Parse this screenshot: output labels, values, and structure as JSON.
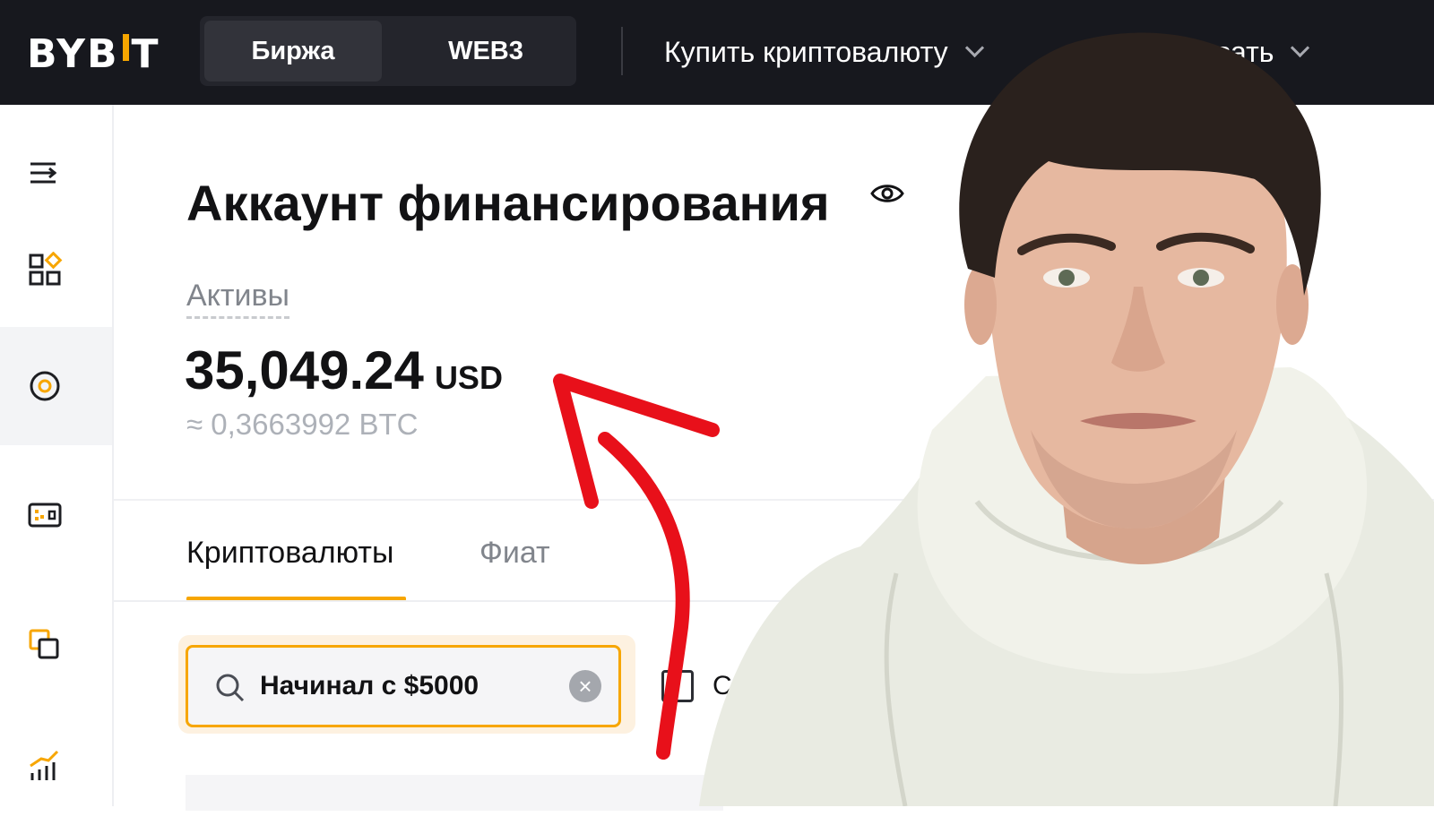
{
  "topbar": {
    "logo": "BYB",
    "logo_suffix": "T",
    "segments": [
      "Биржа",
      "WEB3"
    ],
    "nav": [
      {
        "label": "Купить криптовалюту"
      },
      {
        "label": "Торговать"
      }
    ]
  },
  "sidebar": {
    "items": [
      {
        "icon": "menu-icon"
      },
      {
        "icon": "dashboard-icon"
      },
      {
        "icon": "funding-icon",
        "active": true
      },
      {
        "icon": "wallet-icon"
      },
      {
        "icon": "copy-icon"
      },
      {
        "icon": "chart-icon"
      }
    ]
  },
  "main": {
    "title": "Аккаунт финансирования",
    "assets_label": "Активы",
    "balance": "35,049.24",
    "currency": "USD",
    "btc_equiv": "≈ 0,3663992 BTC",
    "tabs": [
      "Криптовалюты",
      "Фиат"
    ],
    "active_tab": "Криптовалюты",
    "search": {
      "value": "Начинал с $5000"
    },
    "checkbox_label": "Ск"
  },
  "colors": {
    "topbar_bg": "#17181e",
    "accent": "#f7a600",
    "annotation_arrow": "#e8101a"
  }
}
